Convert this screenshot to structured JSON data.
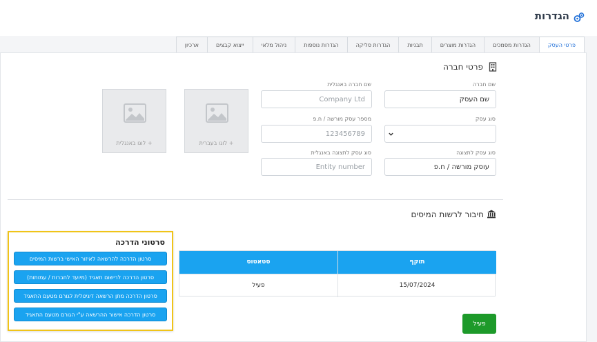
{
  "page": {
    "title": "הגדרות"
  },
  "tabs": [
    {
      "label": "פרטי העסק",
      "active": true
    },
    {
      "label": "הגדרות מסמכים",
      "active": false
    },
    {
      "label": "הגדרות מוצרים",
      "active": false
    },
    {
      "label": "תבניות",
      "active": false
    },
    {
      "label": "הגדרות סליקה",
      "active": false
    },
    {
      "label": "הגדרות נוספות",
      "active": false
    },
    {
      "label": "ניהול מלאי",
      "active": false
    },
    {
      "label": "ייצוא קבצים",
      "active": false
    },
    {
      "label": "ארכיון",
      "active": false
    }
  ],
  "company": {
    "section_title": "פרטי חברה",
    "name_label": "שם חברה",
    "name_value": "שם העסק",
    "name_en_label": "שם חברה באנגלית",
    "name_en_placeholder": "Company Ltd",
    "business_type_label": "סוג עסק",
    "business_type_value": "",
    "license_label": "מספר עסק מורשה / ח.פ",
    "license_placeholder": "123456789",
    "display_type_label": "סוג עסק לתצוגה",
    "display_type_value": "עוסק מורשה / ח.פ",
    "display_type_en_label": "סוג עסק לתצוגה באנגלית",
    "display_type_en_placeholder": "Entity number",
    "logo_hebrew_label": "+ לוגו בעברית",
    "logo_english_label": "+ לוגו באנגלית"
  },
  "tax": {
    "section_title": "חיבור לרשות המיסים",
    "table": {
      "headers": [
        "תוקף",
        "סטאטוס"
      ],
      "rows": [
        {
          "validity": "15/07/2024",
          "status": "פעיל"
        }
      ]
    },
    "status_button": "פעיל"
  },
  "videos": {
    "title": "סרטוני הדרכה",
    "items": [
      "סרטון הדרכה להרשאה לאיזור האישי ברשות המיסים",
      "סרטון הדרכה לרישום תאגיד (מיועד לחברות / עמותות)",
      "סרטון הדרכה מתן הרשאה דיגיטלית לגורם מטעם התאגיד",
      "סרטון הדרכה אישור ההרשאה ע\"י הגורם מטעם התאגיד"
    ]
  },
  "colors": {
    "accent": "#1aa3f0",
    "active_tab": "#1f6fd8",
    "success": "#1d9a2a",
    "highlight": "#f0c419"
  }
}
